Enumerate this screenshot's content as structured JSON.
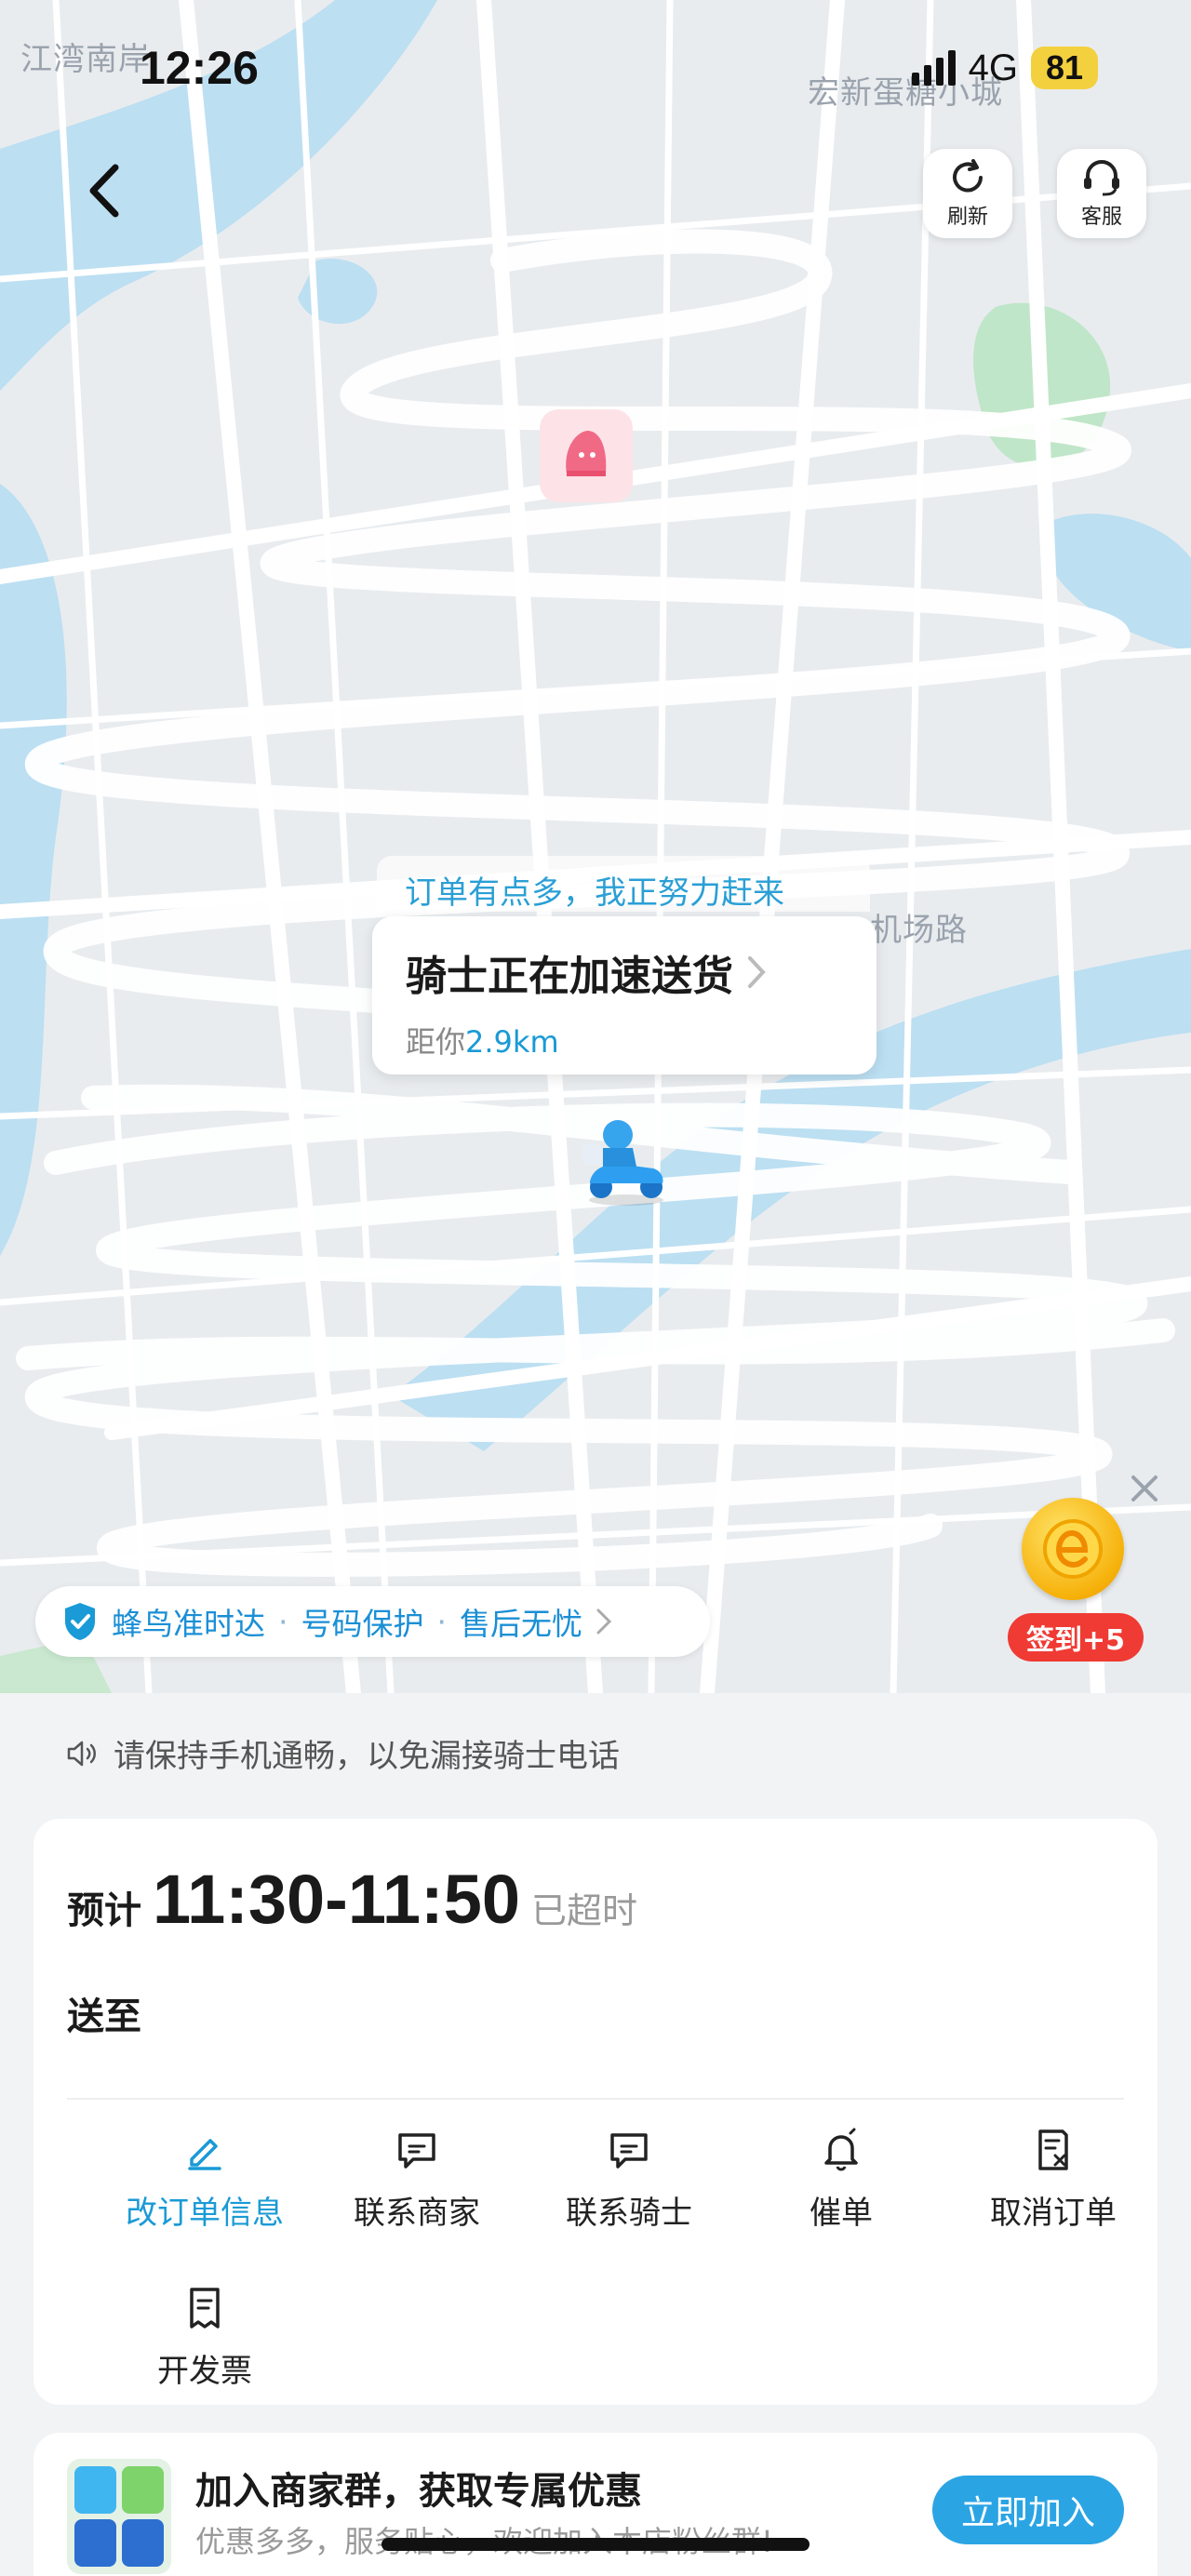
{
  "status_bar": {
    "time": "12:26",
    "network": "4G",
    "battery": "81"
  },
  "map": {
    "labels": [
      "江湾南岸",
      "宏新蛋糖小城",
      "机场路"
    ],
    "actions": [
      {
        "id": "refresh",
        "label": "刷新",
        "icon": "refresh-icon"
      },
      {
        "id": "service",
        "label": "客服",
        "icon": "headset-icon"
      }
    ],
    "rider_tip": "订单有点多，我正努力赶来",
    "rider_status": "骑士正在加速送货",
    "distance_prefix": "距你",
    "distance_value": "2.9km",
    "guarantees": [
      "蜂鸟准时达",
      "号码保护",
      "售后无忧"
    ],
    "signin_badge": "签到+5"
  },
  "notice": "请保持手机通畅，以免漏接骑士电话",
  "order": {
    "eta_prefix": "预计",
    "eta_time": "11:30-11:50",
    "eta_status": "已超时",
    "deliver_to": "送至",
    "actions": [
      {
        "label": "改订单信息",
        "icon": "edit-icon",
        "active": true
      },
      {
        "label": "联系商家",
        "icon": "chat-icon",
        "active": false
      },
      {
        "label": "联系骑士",
        "icon": "chat-icon",
        "active": false
      },
      {
        "label": "催单",
        "icon": "bell-icon",
        "active": false
      },
      {
        "label": "取消订单",
        "icon": "cancel-order-icon",
        "active": false
      },
      {
        "label": "开发票",
        "icon": "invoice-icon",
        "active": false
      }
    ]
  },
  "promo": {
    "title": "加入商家群，获取专属优惠",
    "subtitle": "优惠多多，服务贴心，欢迎加入本店粉丝群!",
    "button": "立即加入"
  },
  "colors": {
    "accent": "#1a9ad6",
    "button": "#2ba4e4",
    "badge": "#ef3b34",
    "battery": "#f3d03e"
  }
}
